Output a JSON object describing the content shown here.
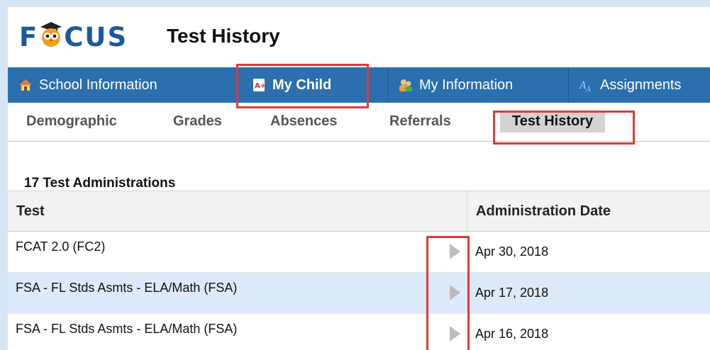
{
  "app": {
    "logo_text_left": "F",
    "logo_text_right": "CUS",
    "page_title": "Test History"
  },
  "nav": {
    "items": [
      {
        "label": "School Information",
        "icon": "home-icon"
      },
      {
        "label": "My Child",
        "icon": "report-card-icon"
      },
      {
        "label": "My Information",
        "icon": "people-icon"
      },
      {
        "label": "Assignments",
        "icon": "assignments-icon"
      }
    ],
    "active": "My Child"
  },
  "subnav": {
    "items": [
      "Demographic",
      "Grades",
      "Absences",
      "Referrals",
      "Test History"
    ],
    "active": "Test History"
  },
  "tests": {
    "count_label": "17 Test Administrations",
    "columns": [
      "Test",
      "Administration Date"
    ],
    "rows": [
      {
        "test": "FCAT 2.0 (FC2)",
        "date": "Apr 30, 2018"
      },
      {
        "test": "FSA - FL Stds Asmts - ELA/Math (FSA)",
        "date": "Apr 17, 2018"
      },
      {
        "test": "FSA - FL Stds Asmts - ELA/Math (FSA)",
        "date": "Apr 16, 2018"
      }
    ]
  },
  "colors": {
    "nav_bg": "#2b6fae",
    "highlight": "#dd3b3b",
    "row_alt": "#ddeafa",
    "logo": "#1a5a9a"
  }
}
